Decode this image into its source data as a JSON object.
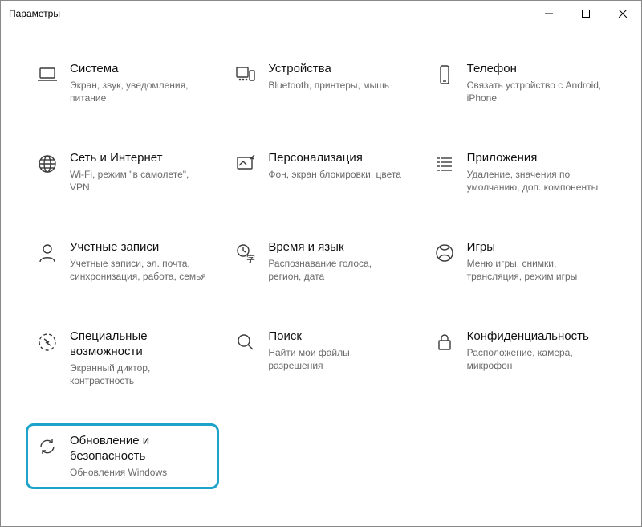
{
  "window": {
    "title": "Параметры"
  },
  "tiles": [
    {
      "id": "system",
      "icon": "laptop",
      "title": "Система",
      "desc": "Экран, звук, уведомления, питание"
    },
    {
      "id": "devices",
      "icon": "devices",
      "title": "Устройства",
      "desc": "Bluetooth, принтеры, мышь"
    },
    {
      "id": "phone",
      "icon": "phone",
      "title": "Телефон",
      "desc": "Связать устройство с Android, iPhone"
    },
    {
      "id": "network",
      "icon": "globe",
      "title": "Сеть и Интернет",
      "desc": "Wi-Fi, режим \"в самолете\", VPN"
    },
    {
      "id": "personalization",
      "icon": "personalization",
      "title": "Персонализация",
      "desc": "Фон, экран блокировки, цвета"
    },
    {
      "id": "apps",
      "icon": "apps",
      "title": "Приложения",
      "desc": "Удаление, значения по умолчанию, доп. компоненты"
    },
    {
      "id": "accounts",
      "icon": "person",
      "title": "Учетные записи",
      "desc": "Учетные записи, эл. почта, синхронизация, работа, семья"
    },
    {
      "id": "time",
      "icon": "time-language",
      "title": "Время и язык",
      "desc": "Распознавание голоса, регион, дата"
    },
    {
      "id": "gaming",
      "icon": "xbox",
      "title": "Игры",
      "desc": "Меню игры, снимки, трансляция, режим игры"
    },
    {
      "id": "ease",
      "icon": "ease-of-access",
      "title": "Специальные возможности",
      "desc": "Экранный диктор, контрастность"
    },
    {
      "id": "search",
      "icon": "search",
      "title": "Поиск",
      "desc": "Найти мои файлы, разрешения"
    },
    {
      "id": "privacy",
      "icon": "lock",
      "title": "Конфиденциальность",
      "desc": "Расположение, камера, микрофон"
    },
    {
      "id": "update",
      "icon": "update",
      "title": "Обновление и безопасность",
      "desc": "Обновления Windows",
      "highlight": true
    }
  ]
}
